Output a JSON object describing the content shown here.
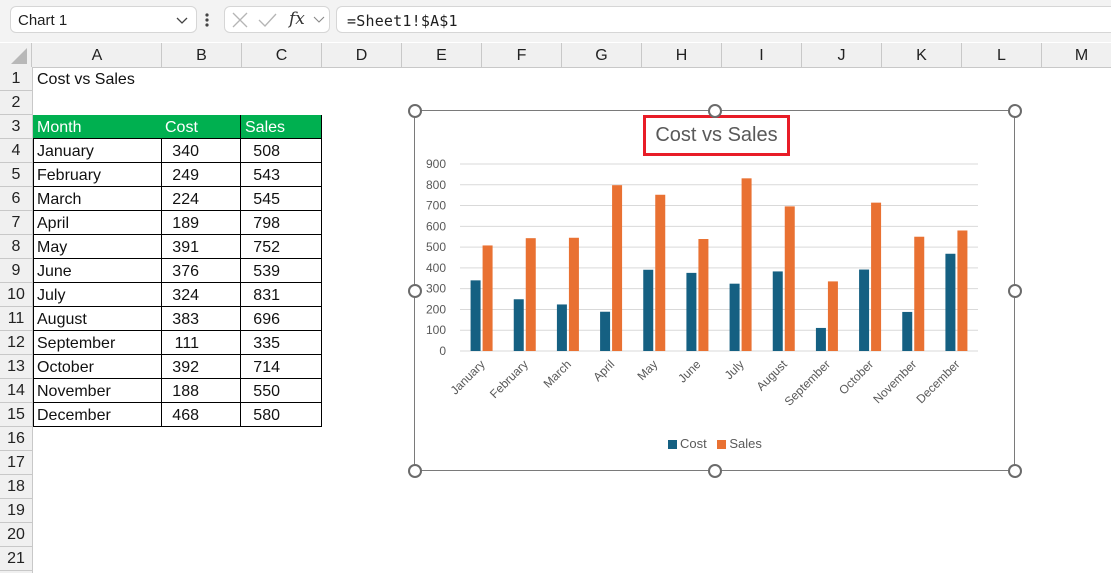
{
  "formula_bar": {
    "name_box": "Chart 1",
    "cancel_icon": "x-icon",
    "enter_icon": "check-icon",
    "function_icon": "fx",
    "formula": "=Sheet1!$A$1"
  },
  "columns": [
    "A",
    "B",
    "C",
    "D",
    "E",
    "F",
    "G",
    "H",
    "I",
    "J",
    "K",
    "L",
    "M"
  ],
  "rows": [
    "1",
    "2",
    "3",
    "4",
    "5",
    "6",
    "7",
    "8",
    "9",
    "10",
    "11",
    "12",
    "13",
    "14",
    "15",
    "16",
    "17",
    "18",
    "19",
    "20",
    "21"
  ],
  "sheet": {
    "a1": "Cost vs Sales",
    "table": {
      "headers": [
        "Month",
        "Cost",
        "Sales"
      ],
      "header_color": "#00b050",
      "rows": [
        [
          "January",
          "340",
          "508"
        ],
        [
          "February",
          "249",
          "543"
        ],
        [
          "March",
          "224",
          "545"
        ],
        [
          "April",
          "189",
          "798"
        ],
        [
          "May",
          "391",
          "752"
        ],
        [
          "June",
          "376",
          "539"
        ],
        [
          "July",
          "324",
          "831"
        ],
        [
          "August",
          "383",
          "696"
        ],
        [
          "September",
          "111",
          "335"
        ],
        [
          "October",
          "392",
          "714"
        ],
        [
          "November",
          "188",
          "550"
        ],
        [
          "December",
          "468",
          "580"
        ]
      ]
    }
  },
  "chart_data": {
    "type": "bar",
    "title": "Cost vs Sales",
    "title_highlight_color": "#e81c27",
    "categories": [
      "January",
      "February",
      "March",
      "April",
      "May",
      "June",
      "July",
      "August",
      "September",
      "October",
      "November",
      "December"
    ],
    "series": [
      {
        "name": "Cost",
        "color": "#156082",
        "values": [
          340,
          249,
          224,
          189,
          391,
          376,
          324,
          383,
          111,
          392,
          188,
          468
        ]
      },
      {
        "name": "Sales",
        "color": "#e97132",
        "values": [
          508,
          543,
          545,
          798,
          752,
          539,
          831,
          696,
          335,
          714,
          550,
          580
        ]
      }
    ],
    "yticks": [
      "0",
      "100",
      "200",
      "300",
      "400",
      "500",
      "600",
      "700",
      "800",
      "900"
    ],
    "ylim": [
      0,
      900
    ],
    "xlabel": "",
    "ylabel": "",
    "grid": true,
    "legend": "bottom"
  }
}
